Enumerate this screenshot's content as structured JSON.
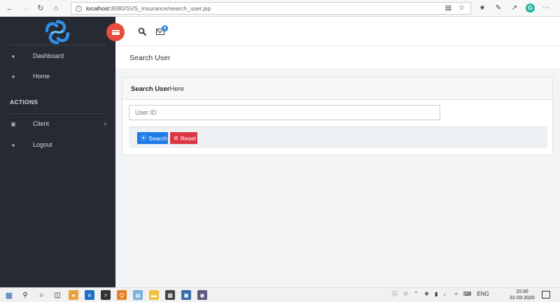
{
  "browser": {
    "url_host": "localhost",
    "url_path": ":8080/SVS_Insurance/search_user.jsp",
    "profile_initial": "G"
  },
  "sidebar": {
    "items": [
      {
        "label": "Dashboard",
        "icon": "dashboard-icon"
      },
      {
        "label": "Home",
        "icon": "dashboard-icon"
      }
    ],
    "section_title": "ACTIONS",
    "actions": [
      {
        "label": "Client",
        "icon": "laptop-icon",
        "has_submenu": true
      },
      {
        "label": "Logout",
        "icon": "dashboard-icon",
        "has_submenu": false
      }
    ]
  },
  "header": {
    "mail_badge_count": "0"
  },
  "main": {
    "page_title": "Search User",
    "card": {
      "title_bold": "Search User",
      "title_rest": "Here",
      "user_id_placeholder": "User ID",
      "search_label": "Search",
      "reset_label": "Reset"
    }
  },
  "taskbar": {
    "language": "ENG",
    "time": "10:30",
    "date": "31-03-2020"
  },
  "colors": {
    "sidebar_bg": "#262a33",
    "toggle_red": "#e74c3c",
    "search_blue": "#1e7be8",
    "reset_red": "#dc3545"
  }
}
